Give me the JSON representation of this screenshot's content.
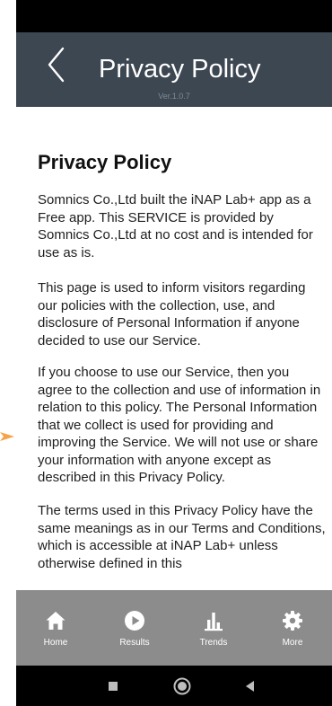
{
  "header": {
    "title": "Privacy Policy",
    "version": "Ver.1.0.7"
  },
  "content": {
    "heading": "Privacy Policy",
    "paragraphs": [
      "Somnics Co.,Ltd built the iNAP Lab+ app as a Free app. This SERVICE is provided by Somnics Co.,Ltd at no cost and is intended for use as is.",
      "This page is used to inform visitors regarding our policies with the collection, use, and disclosure of Personal Information if anyone decided to use our Service.",
      "If you choose to use our Service, then you agree to the collection and use of information in relation to this policy. The Personal Information that we collect is used for providing and improving the Service. We will not use or share your information with anyone except as described in this Privacy Policy.",
      "The terms used in this Privacy Policy have the same meanings as in our Terms and Conditions, which is accessible at iNAP Lab+ unless otherwise defined in this"
    ]
  },
  "bottom_nav": {
    "items": [
      {
        "label": "Home",
        "icon": "home-icon"
      },
      {
        "label": "Results",
        "icon": "play-circle-icon"
      },
      {
        "label": "Trends",
        "icon": "bar-chart-icon"
      },
      {
        "label": "More",
        "icon": "gear-icon"
      }
    ]
  },
  "system_nav": {
    "buttons": [
      "recents-square-icon",
      "home-circle-icon",
      "back-triangle-icon"
    ]
  },
  "colors": {
    "header_bg": "#3d4752",
    "nav_bg": "#8c8c8c",
    "status_bg": "#000000",
    "pointer_arrow": "#f5a34a"
  }
}
